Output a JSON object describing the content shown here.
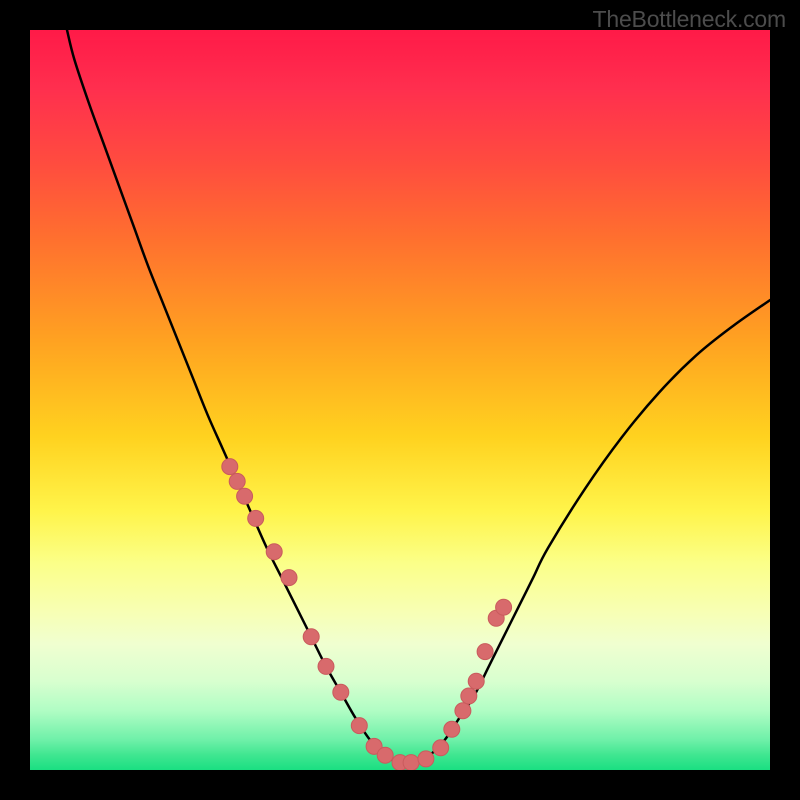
{
  "watermark": "TheBottleneck.com",
  "chart_data": {
    "type": "line",
    "title": "",
    "xlabel": "",
    "ylabel": "",
    "xlim": [
      0,
      100
    ],
    "ylim": [
      0,
      100
    ],
    "grid": false,
    "legend": false,
    "curve_color": "#000000",
    "curve_stroke": 2.5,
    "marker_color": "#d86a6c",
    "marker_stroke": "#c95b5d",
    "marker_radius_px": 8,
    "x": [
      5,
      6,
      8,
      10,
      12,
      14,
      16,
      18,
      20,
      22,
      24,
      26,
      28,
      30,
      32,
      34,
      36,
      38,
      40,
      42,
      44,
      46,
      48,
      50,
      52,
      54,
      56,
      58,
      60,
      62,
      64,
      66,
      68,
      70,
      75,
      80,
      85,
      90,
      95,
      100
    ],
    "y": [
      100,
      96,
      90,
      84.5,
      79,
      73.5,
      68,
      63,
      58,
      53,
      48,
      43.5,
      39,
      34.5,
      30,
      26,
      22,
      18,
      14,
      10.5,
      7,
      4,
      2,
      1,
      1,
      2,
      4,
      7,
      10,
      14,
      18,
      22,
      26,
      30,
      38,
      45,
      51,
      56,
      60,
      63.5
    ],
    "markers": {
      "x": [
        27,
        28,
        29,
        30.5,
        33,
        35,
        38,
        40,
        42,
        44.5,
        46.5,
        48,
        50,
        51.5,
        53.5,
        55.5,
        57,
        58.5,
        59.3,
        60.3,
        61.5,
        63,
        64
      ],
      "y": [
        41,
        39,
        37,
        34,
        29.5,
        26,
        18,
        14,
        10.5,
        6,
        3.2,
        2,
        1,
        1,
        1.5,
        3,
        5.5,
        8,
        10,
        12,
        16,
        20.5,
        22
      ]
    }
  }
}
